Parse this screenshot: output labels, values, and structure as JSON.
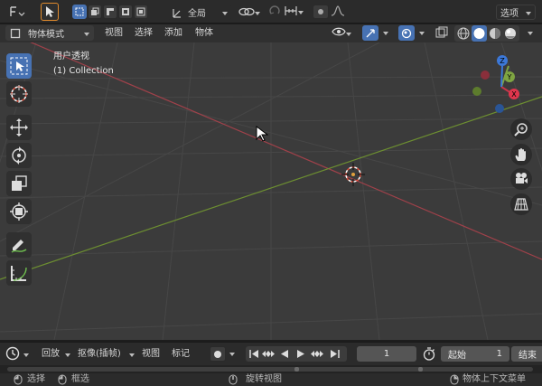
{
  "topbar": {
    "transform_pivot_icon": "transform-orientation-icon",
    "select_mode_icon": "select-box-icon",
    "orientation": "全局",
    "options_label": "选项"
  },
  "header": {
    "mode": "物体模式",
    "menu": [
      "视图",
      "选择",
      "添加",
      "物体"
    ]
  },
  "viewport": {
    "view_name": "用户透视",
    "collection": "(1) Collection",
    "axes": {
      "x": "X",
      "y": "Y",
      "z": "Z"
    },
    "colors": {
      "x_axis": "#d13a4b",
      "y_axis": "#7ba33a",
      "z_axis": "#3c78d8",
      "bg": "#3b3b3b",
      "accent": "#4772b3"
    }
  },
  "timeline": {
    "menu": [
      "回放",
      "抠像(插帧)",
      "视图",
      "标记"
    ],
    "current_frame": "1",
    "start_label": "起始",
    "start_value": "1",
    "end_label": "结束"
  },
  "status": {
    "select": "选择",
    "box_select": "框选",
    "rotate_view": "旋转视图",
    "context_menu": "物体上下文菜单"
  }
}
